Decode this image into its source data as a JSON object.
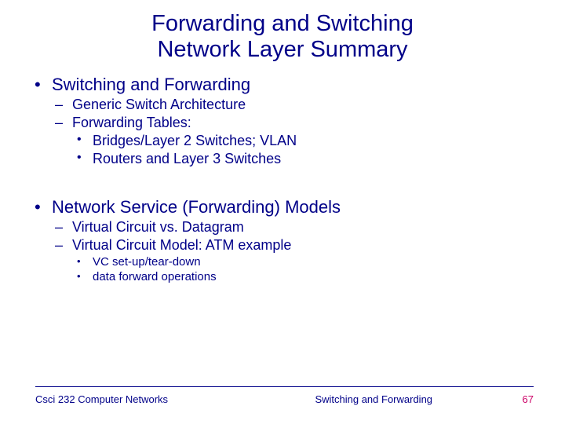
{
  "title_line1": "Forwarding and Switching",
  "title_line2": "Network Layer Summary",
  "section1": {
    "heading": "Switching and Forwarding",
    "items": [
      "Generic Switch Architecture",
      "Forwarding Tables:"
    ],
    "subitems": [
      "Bridges/Layer 2 Switches; VLAN",
      "Routers and Layer 3 Switches"
    ]
  },
  "section2": {
    "heading": "Network Service (Forwarding) Models",
    "items": [
      "Virtual Circuit vs. Datagram",
      "Virtual Circuit Model:  ATM example"
    ],
    "subitems": [
      "VC set-up/tear-down",
      "data forward operations"
    ]
  },
  "footer": {
    "left": "Csci 232 Computer Networks",
    "center": "Switching and Forwarding",
    "page": "67"
  }
}
